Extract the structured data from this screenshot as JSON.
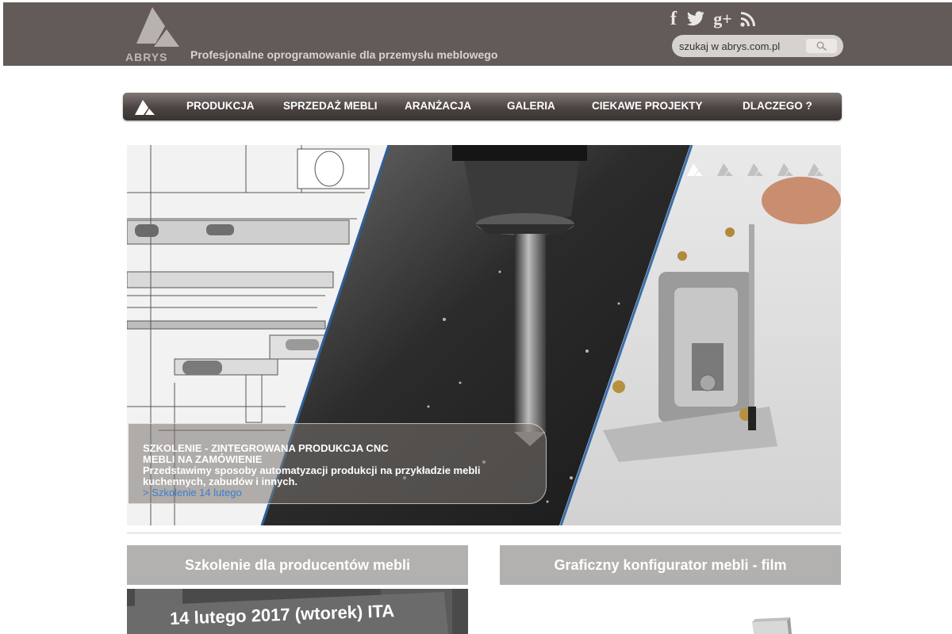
{
  "header": {
    "logo_text": "ABRYS",
    "tagline": "Profesjonalne oprogramowanie dla przemysłu meblowego",
    "social": {
      "facebook": "f",
      "googleplus": "g+"
    },
    "search": {
      "value": "szukaj w abrys.com.pl"
    }
  },
  "nav": {
    "items": [
      {
        "label": "PRODUKCJA"
      },
      {
        "label": "SPRZEDAŻ MEBLI"
      },
      {
        "label": "ARANŻACJA"
      },
      {
        "label": "GALERIA"
      },
      {
        "label": "CIEKAWE PROJEKTY"
      },
      {
        "label": "DLACZEGO ?"
      }
    ]
  },
  "hero": {
    "caption_title_line1": "SZKOLENIE - ZINTEGROWANA PRODUKCJA CNC",
    "caption_title_line2": "MEBLI NA ZAMÓWIENIE",
    "caption_desc_line1": "Przedstawimy sposoby automatyzacji produkcji na przykładzie mebli",
    "caption_desc_line2": "kuchennych, zabudów i innych.",
    "caption_link": "> Szkolenie 14 lutego",
    "slide_count": 5
  },
  "boxes": [
    {
      "title": "Szkolenie dla producentów mebli",
      "image_text": "14 lutego 2017 (wtorek) ITA"
    },
    {
      "title": "Graficzny konfigurator mebli - film"
    }
  ],
  "colors": {
    "header_bg": "#625b58",
    "nav_bg": "#4a4341",
    "box_header_bg": "#b3b1af",
    "link": "#3c7dd0"
  }
}
